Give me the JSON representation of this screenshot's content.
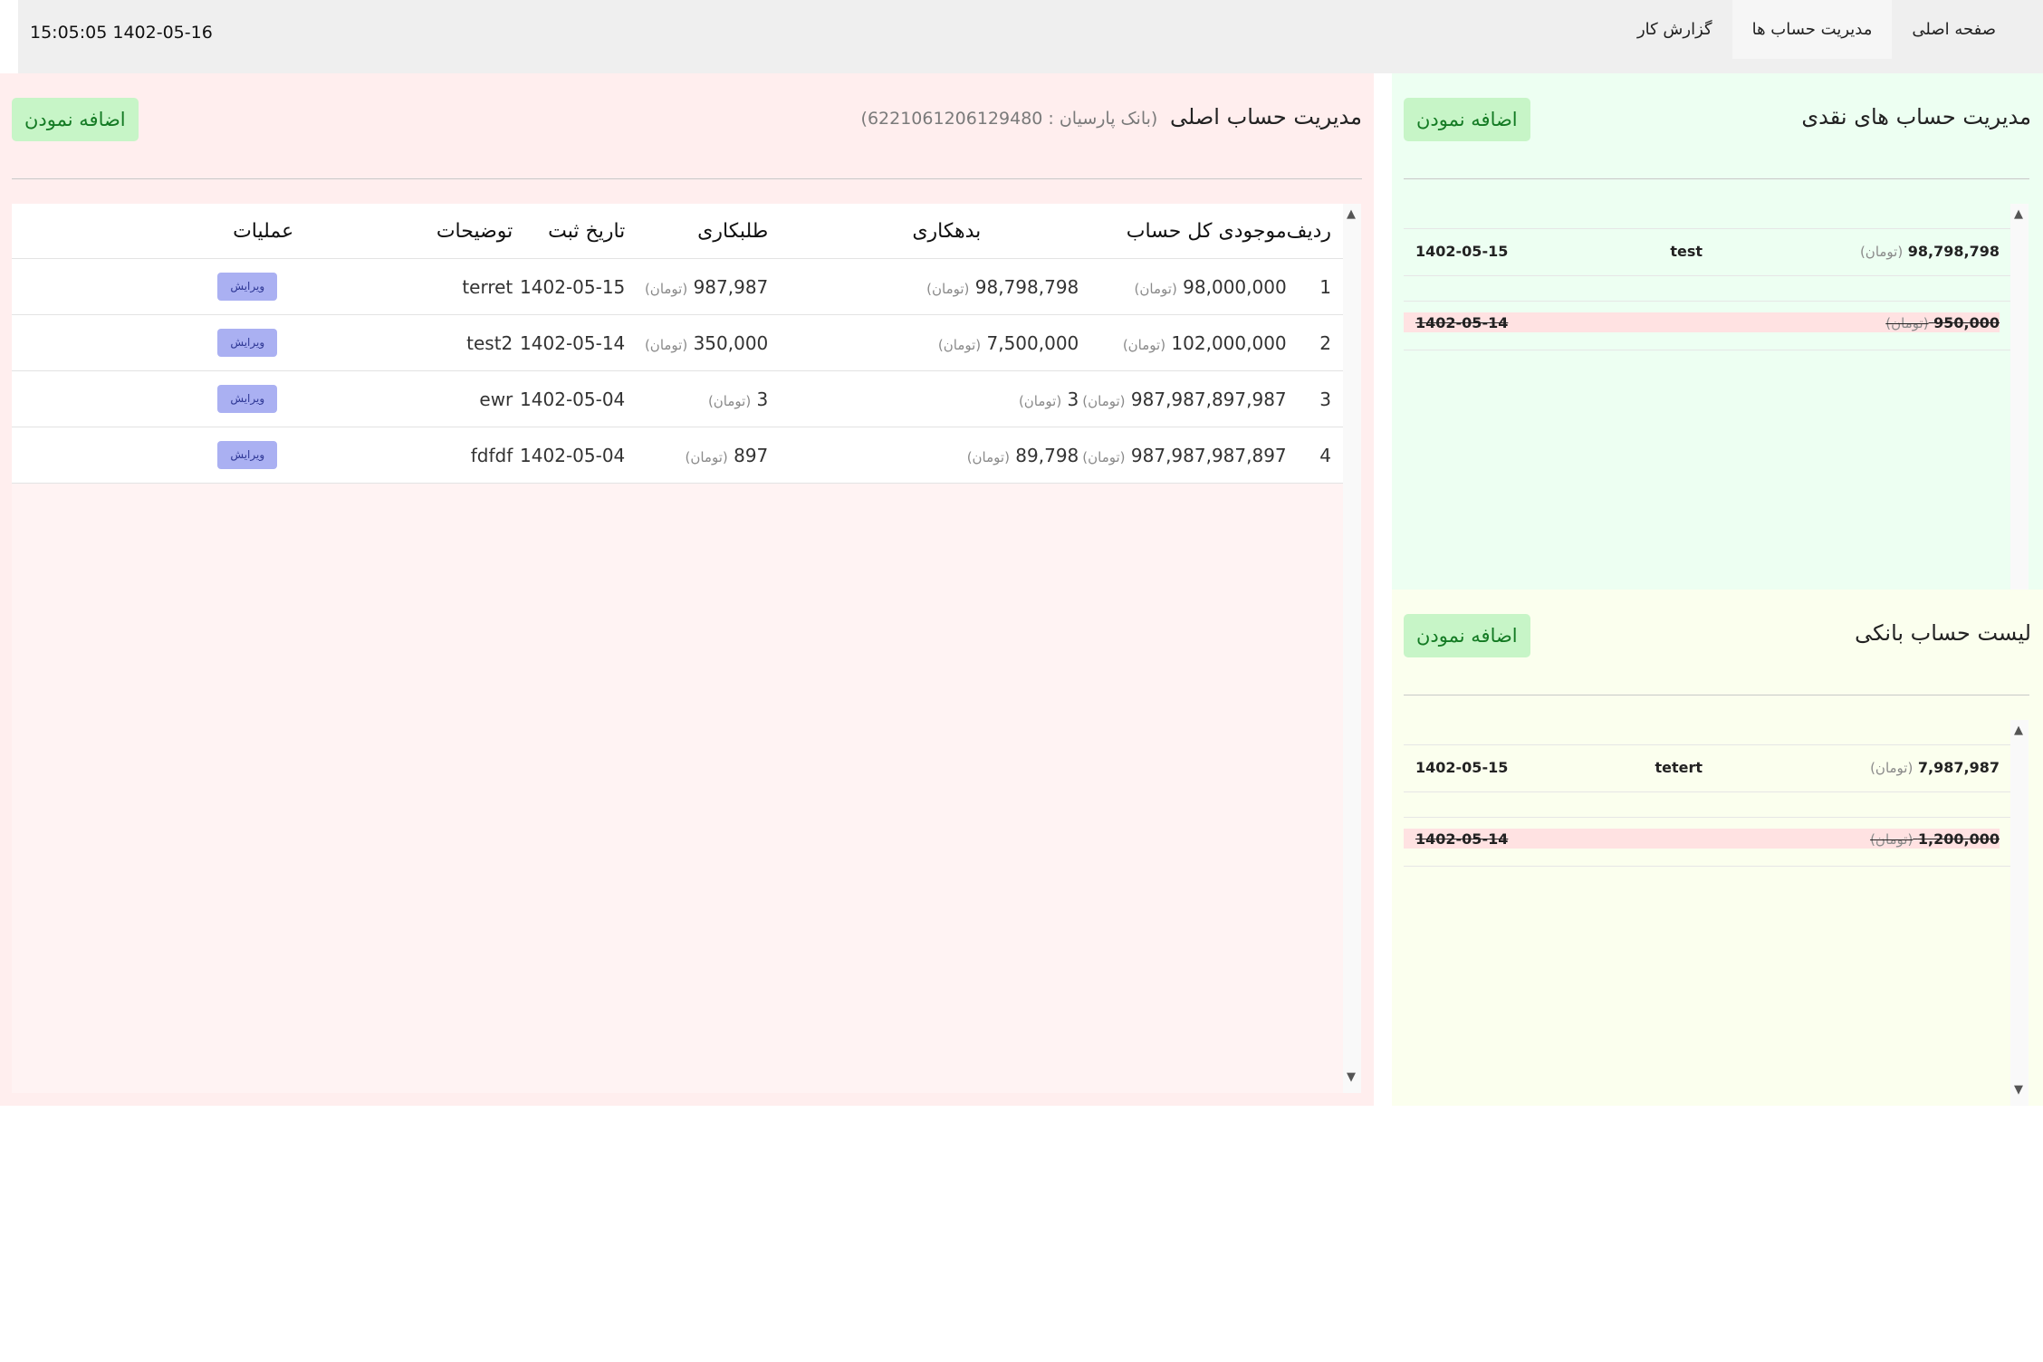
{
  "header": {
    "datetime": "15:05:05 1402-05-16",
    "nav": [
      {
        "label": "صفحه اصلی"
      },
      {
        "label": "مدیریت حساب ها"
      },
      {
        "label": "گزارش کار"
      }
    ]
  },
  "main_account": {
    "title": "مدیریت حساب اصلی",
    "subtitle": "(بانک پارسیان : 6221061206129480)",
    "add_label": "اضافه نمودن",
    "columns": [
      "ردیف",
      "موجودی کل حساب",
      "بدهکاری",
      "طلبکاری",
      "تاریخ ثبت",
      "توضیحات",
      "عملیات"
    ],
    "unit": "(تومان)",
    "edit_label": "ویرایش",
    "rows": [
      {
        "index": "1",
        "balance": "98,000,000",
        "debit": "98,798,798",
        "credit": "987,987",
        "date": "1402-05-15",
        "desc": "terret"
      },
      {
        "index": "2",
        "balance": "102,000,000",
        "debit": "7,500,000",
        "credit": "350,000",
        "date": "1402-05-14",
        "desc": "test2"
      },
      {
        "index": "3",
        "balance": "987,987,897,987",
        "debit": "3",
        "credit": "3",
        "date": "1402-05-04",
        "desc": "ewr"
      },
      {
        "index": "4",
        "balance": "987,987,987,897",
        "debit": "89,798",
        "credit": "897",
        "date": "1402-05-04",
        "desc": "fdfdf"
      }
    ]
  },
  "cash_accounts": {
    "title": "مدیریت حساب های نقدی",
    "add_label": "اضافه نمودن",
    "unit": "(تومان)",
    "rows": [
      {
        "amount": "98,798,798",
        "desc": "test",
        "date": "1402-05-15",
        "deleted": false
      },
      {
        "amount": "950,000",
        "desc": "",
        "date": "1402-05-14",
        "deleted": true
      }
    ]
  },
  "bank_accounts": {
    "title": "لیست حساب بانکی",
    "add_label": "اضافه نمودن",
    "unit": "(تومان)",
    "rows": [
      {
        "amount": "7,987,987",
        "desc": "tetert",
        "date": "1402-05-15",
        "deleted": false
      },
      {
        "amount": "1,200,000",
        "desc": "",
        "date": "1402-05-14",
        "deleted": true
      }
    ]
  },
  "icons": {
    "scroll_up": "triangle-up-icon",
    "scroll_down": "triangle-down-icon"
  }
}
